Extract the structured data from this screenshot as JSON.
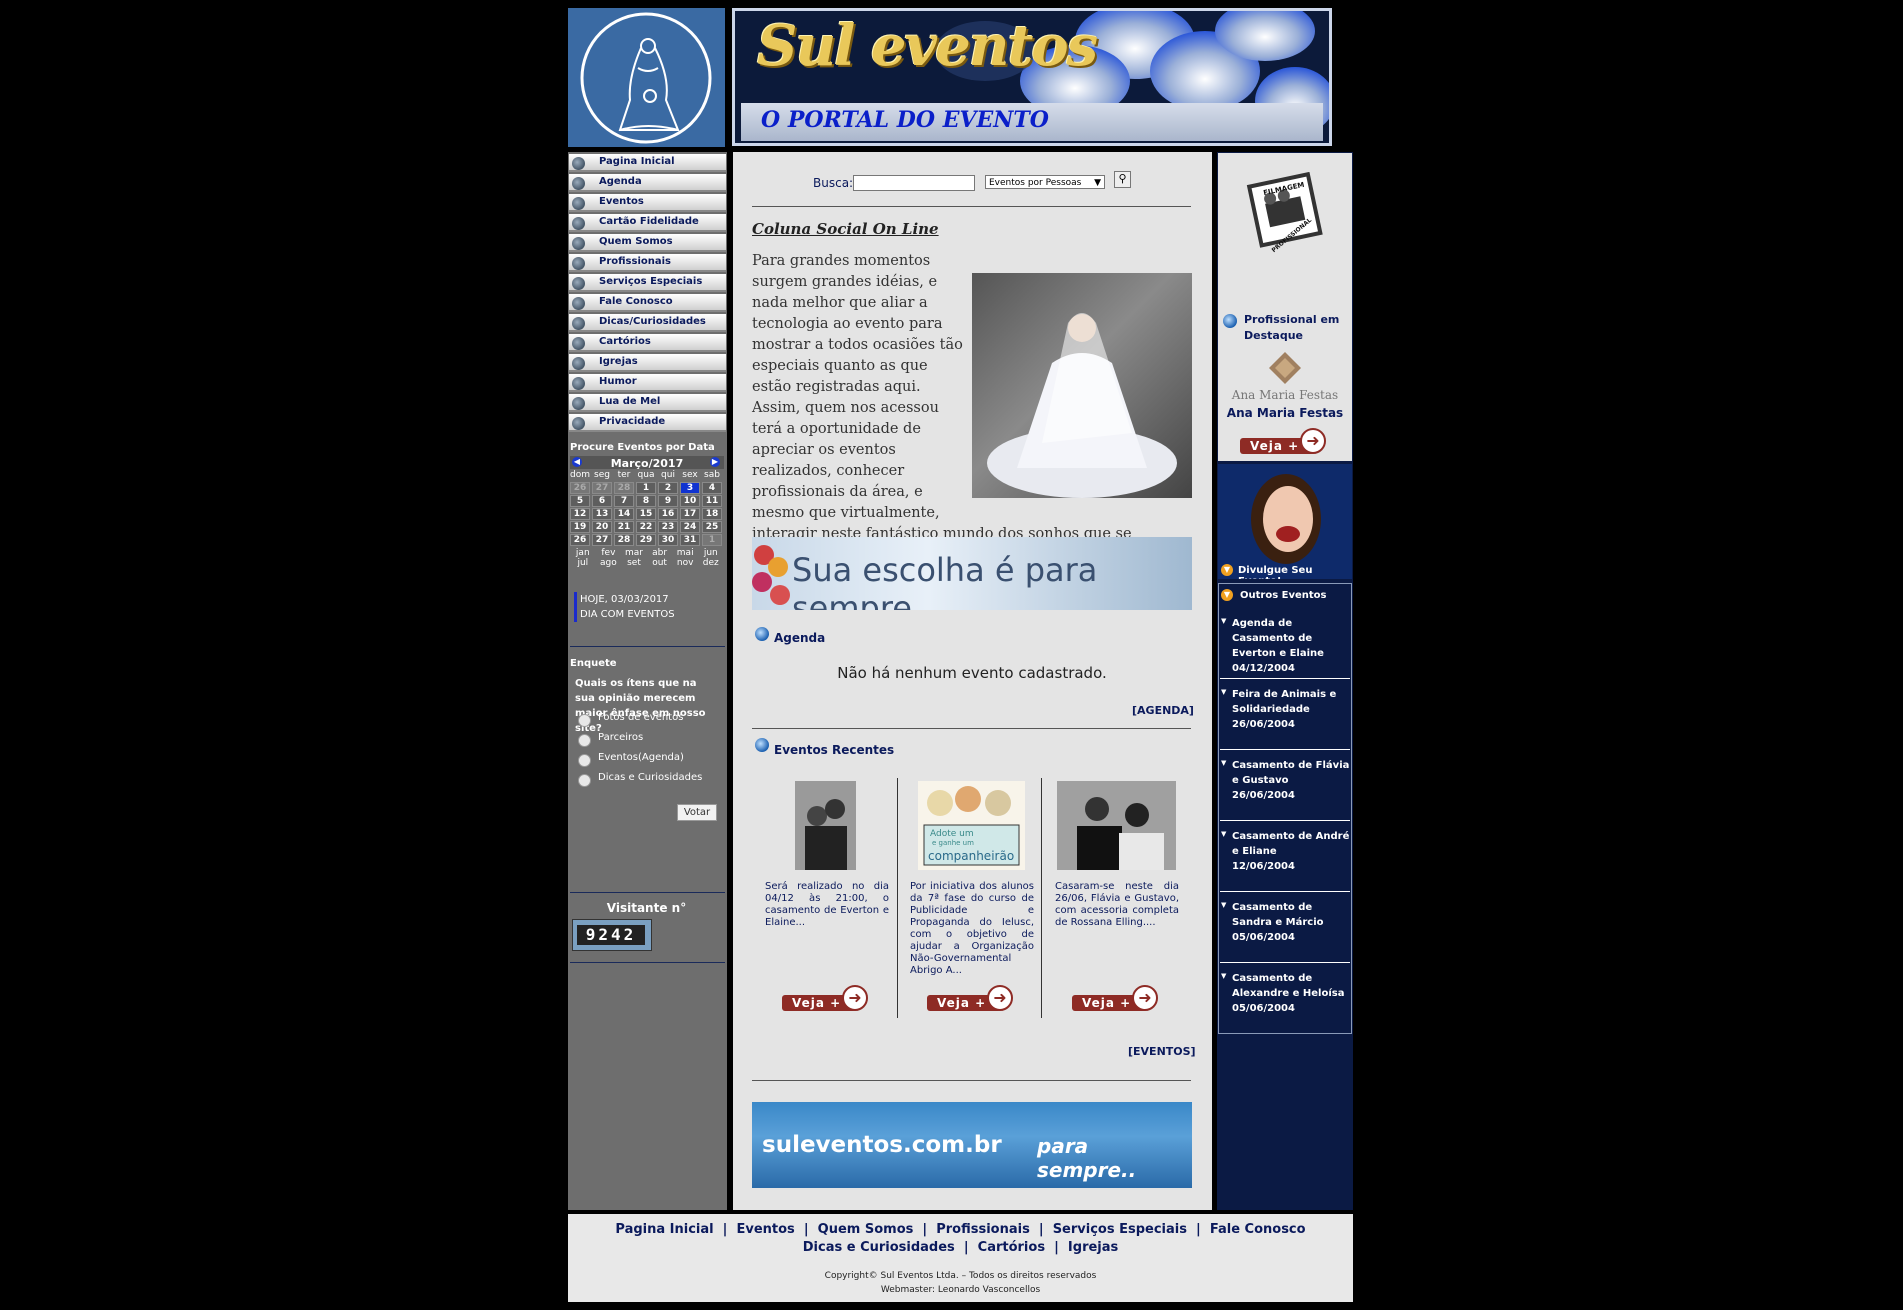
{
  "header": {
    "title": "Sul eventos",
    "subtitle": "O PORTAL DO EVENTO"
  },
  "menu": [
    "Pagina Inicial",
    "Agenda",
    "Eventos",
    "Cartão Fidelidade",
    "Quem Somos",
    "Profissionais",
    "Serviços Especiais",
    "Fale Conosco",
    "Dicas/Curiosidades",
    "Cartórios",
    "Igrejas",
    "Humor",
    "Lua de Mel",
    "Privacidade"
  ],
  "calendar": {
    "title": "Procure Eventos por Data",
    "month": "Março/2017",
    "weekdays": [
      "dom",
      "seg",
      "ter",
      "qua",
      "qui",
      "sex",
      "sab"
    ],
    "weeks": [
      [
        "26",
        "27",
        "28",
        "1",
        "2",
        "3",
        "4"
      ],
      [
        "5",
        "6",
        "7",
        "8",
        "9",
        "10",
        "11"
      ],
      [
        "12",
        "13",
        "14",
        "15",
        "16",
        "17",
        "18"
      ],
      [
        "19",
        "20",
        "21",
        "22",
        "23",
        "24",
        "25"
      ],
      [
        "26",
        "27",
        "28",
        "29",
        "30",
        "31",
        "1"
      ]
    ],
    "today": "3",
    "months_row1": [
      "jan",
      "fev",
      "mar",
      "abr",
      "mai",
      "jun"
    ],
    "months_row2": [
      "jul",
      "ago",
      "set",
      "out",
      "nov",
      "dez"
    ]
  },
  "today_box": {
    "line1": "HOJE, 03/03/2017",
    "line2": "DIA COM EVENTOS"
  },
  "poll": {
    "title": "Enquete",
    "question": "Quais os ítens que na sua opinião merecem maior ênfase em nosso site?",
    "options": [
      "Fotos de eventos",
      "Parceiros",
      "Eventos(Agenda)",
      "Dicas e Curiosidades"
    ],
    "vote_button": "Votar"
  },
  "visitors": {
    "label": "Visitante n°",
    "count": "9242"
  },
  "search": {
    "label": "Busca:",
    "value": "",
    "select_value": "Eventos por Pessoas"
  },
  "column": {
    "title": "Coluna Social On Line",
    "text": "Para grandes momentos surgem grandes idéias, e nada melhor que aliar a tecnologia ao evento para mostrar a todos ocasiões tão especiais quanto as que estão registradas aqui. Assim, quem nos acessou terá a oportunidade de apreciar os eventos realizados, conhecer profissionais da área, e mesmo que virtualmente, interagir neste fantástico mundo dos sonhos que se tornaram realidade."
  },
  "banner_mid": {
    "text": "Sua escolha é para sempre."
  },
  "agenda": {
    "title": "Agenda",
    "empty": "Não há nenhum evento cadastrado.",
    "link": "[AGENDA]"
  },
  "recent": {
    "title": "Eventos Recentes",
    "items": [
      {
        "text": "Será realizado no dia 04/12 às 21:00, o casamento de Everton e Elaine..."
      },
      {
        "text": "Por iniciativa dos alunos da 7ª fase do curso de Publicidade e Propaganda do Ielusc, com o objetivo de ajudar a Organização Não-Governamental Abrigo A..."
      },
      {
        "text": "Casaram-se neste dia 26/06, Flávia e Gustavo, com acessoria completa de Rossana Elling...."
      }
    ],
    "veja": "Veja +",
    "link": "[EVENTOS]",
    "adote_lines": [
      "Adote um",
      "e ganhe um",
      "companheirão"
    ]
  },
  "banner_bottom": {
    "text": "suleventos.com.br",
    "tag": "para sempre.."
  },
  "right": {
    "badge_text": [
      "FILMAGEM",
      "PROFISSIONAL"
    ],
    "prof_title": "Profissional em Destaque",
    "prof_logo": "Ana Maria Festas",
    "prof_name": "Ana Maria Festas",
    "veja": "Veja +",
    "divulgue": "Divulgue Seu Evento!",
    "outros": "Outros Eventos",
    "events": [
      {
        "title": "Agenda de Casamento de Everton e Elaine",
        "date": "04/12/2004"
      },
      {
        "title": "Feira de Animais e Solidariedade",
        "date": "26/06/2004"
      },
      {
        "title": "Casamento de Flávia e Gustavo",
        "date": "26/06/2004"
      },
      {
        "title": "Casamento de André e Eliane",
        "date": "12/06/2004"
      },
      {
        "title": "Casamento de Sandra e Márcio",
        "date": "05/06/2004"
      },
      {
        "title": "Casamento de Alexandre e Heloísa",
        "date": "05/06/2004"
      }
    ]
  },
  "footer": {
    "links_row1": [
      "Pagina Inicial",
      "Eventos",
      "Quem Somos",
      "Profissionais",
      "Serviços Especiais",
      "Fale Conosco"
    ],
    "links_row2": [
      "Dicas e Curiosidades",
      "Cartórios",
      "Igrejas"
    ],
    "copyright": "Copyright© Sul Eventos Ltda. – Todos os direitos reservados",
    "webmaster": "Webmaster: Leonardo Vasconcellos"
  }
}
